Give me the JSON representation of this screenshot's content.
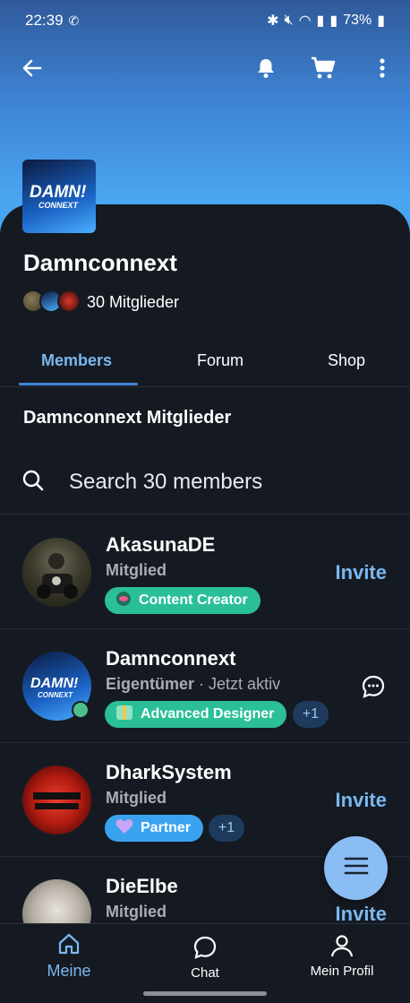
{
  "status_bar": {
    "time": "22:39",
    "battery": "73%"
  },
  "group": {
    "name": "Damnconnext",
    "member_count": "30 Mitglieder",
    "logo_text_top": "DAMN!",
    "logo_text_bottom": "CONNEXT"
  },
  "tabs": [
    {
      "label": "Members"
    },
    {
      "label": "Forum"
    },
    {
      "label": "Shop"
    }
  ],
  "section_title": "Damnconnext Mitglieder",
  "search": {
    "placeholder": "Search 30 members"
  },
  "members": [
    {
      "name": "AkasunaDE",
      "role": "Mitglied",
      "badge": "Content Creator",
      "action": "Invite"
    },
    {
      "name": "Damnconnext",
      "role": "Eigentümer",
      "status": "Jetzt aktiv",
      "badge": "Advanced Designer",
      "extra": "+1"
    },
    {
      "name": "DharkSystem",
      "role": "Mitglied",
      "badge": "Partner",
      "extra": "+1",
      "action": "Invite"
    },
    {
      "name": "DieElbe",
      "role": "Mitglied",
      "action": "Invite"
    }
  ],
  "bottom_nav": [
    {
      "label": "Meine"
    },
    {
      "label": "Chat"
    },
    {
      "label": "Mein Profil"
    }
  ],
  "colors": {
    "accent": "#7ab8ef",
    "background": "#151a22",
    "content_creator": "#2bbf97",
    "advanced_designer": "#2bbf97",
    "partner": "#3aa3f0"
  }
}
